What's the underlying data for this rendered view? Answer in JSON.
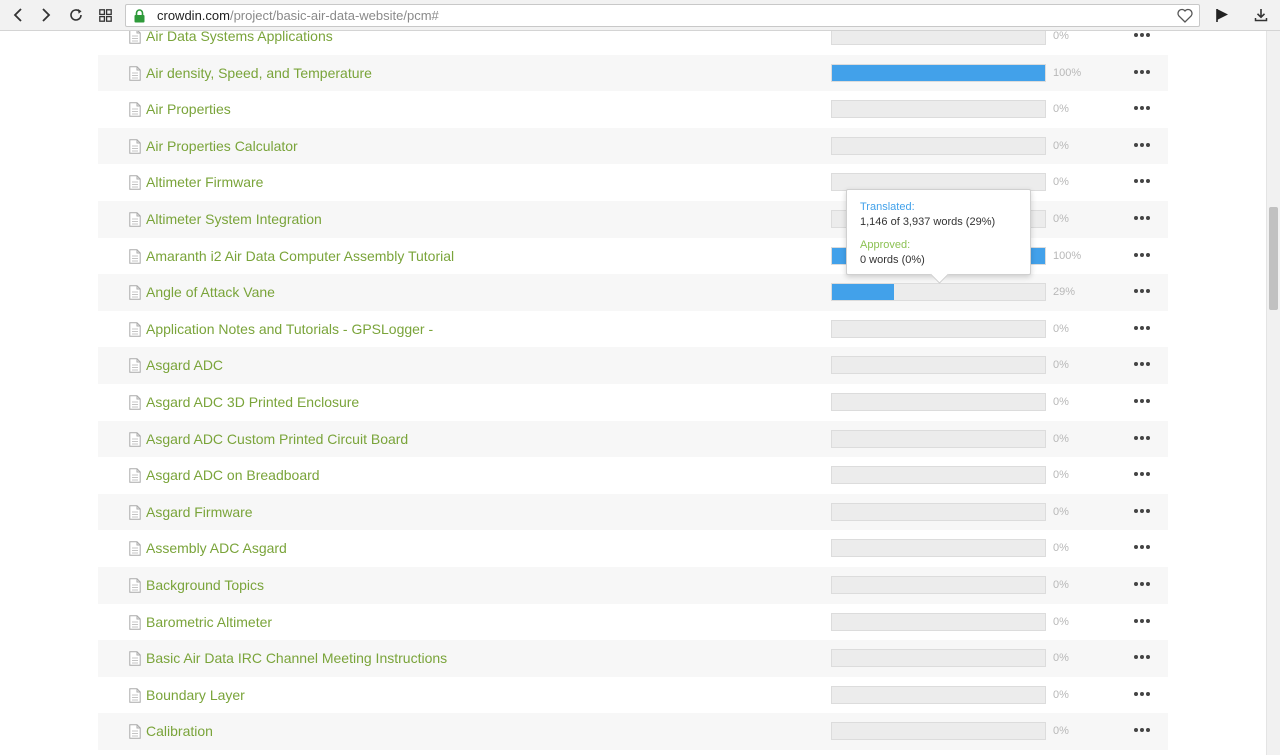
{
  "browser": {
    "url_host": "crowdin.com",
    "url_path": "/project/basic-air-data-website/pcm#"
  },
  "files": [
    {
      "name": "Air Data Systems Applications",
      "progress": 0,
      "pct": "0%"
    },
    {
      "name": "Air density, Speed, and Temperature",
      "progress": 100,
      "pct": "100%"
    },
    {
      "name": "Air Properties",
      "progress": 0,
      "pct": "0%"
    },
    {
      "name": "Air Properties Calculator",
      "progress": 0,
      "pct": "0%"
    },
    {
      "name": "Altimeter Firmware",
      "progress": 0,
      "pct": "0%"
    },
    {
      "name": "Altimeter System Integration",
      "progress": 0,
      "pct": "0%"
    },
    {
      "name": "Amaranth i2 Air Data Computer Assembly Tutorial",
      "progress": 100,
      "pct": "100%"
    },
    {
      "name": "Angle of Attack Vane",
      "progress": 29,
      "pct": "29%"
    },
    {
      "name": "Application Notes and Tutorials - GPSLogger -",
      "progress": 0,
      "pct": "0%"
    },
    {
      "name": "Asgard ADC",
      "progress": 0,
      "pct": "0%"
    },
    {
      "name": "Asgard ADC 3D Printed Enclosure",
      "progress": 0,
      "pct": "0%"
    },
    {
      "name": "Asgard ADC Custom Printed Circuit Board",
      "progress": 0,
      "pct": "0%"
    },
    {
      "name": "Asgard ADC on Breadboard",
      "progress": 0,
      "pct": "0%"
    },
    {
      "name": "Asgard Firmware",
      "progress": 0,
      "pct": "0%"
    },
    {
      "name": "Assembly ADC Asgard",
      "progress": 0,
      "pct": "0%"
    },
    {
      "name": "Background Topics",
      "progress": 0,
      "pct": "0%"
    },
    {
      "name": "Barometric Altimeter",
      "progress": 0,
      "pct": "0%"
    },
    {
      "name": "Basic Air Data IRC Channel Meeting Instructions",
      "progress": 0,
      "pct": "0%"
    },
    {
      "name": "Boundary Layer",
      "progress": 0,
      "pct": "0%"
    },
    {
      "name": "Calibration",
      "progress": 0,
      "pct": "0%"
    }
  ],
  "tooltip": {
    "translated_label": "Translated:",
    "translated_value": "1,146 of 3,937 words (29%)",
    "approved_label": "Approved:",
    "approved_value": "0 words (0%)"
  },
  "colors": {
    "link": "#7aa43a",
    "progress": "#42a1ea",
    "approved": "#8cc152"
  },
  "icons": {
    "back": "chevron-left-icon",
    "forward": "chevron-right-icon",
    "reload": "reload-icon",
    "apps": "grid-icon",
    "lock": "lock-icon",
    "bookmark": "heart-icon",
    "share": "flag-icon",
    "download": "download-icon",
    "file": "document-icon",
    "more": "more-icon"
  }
}
